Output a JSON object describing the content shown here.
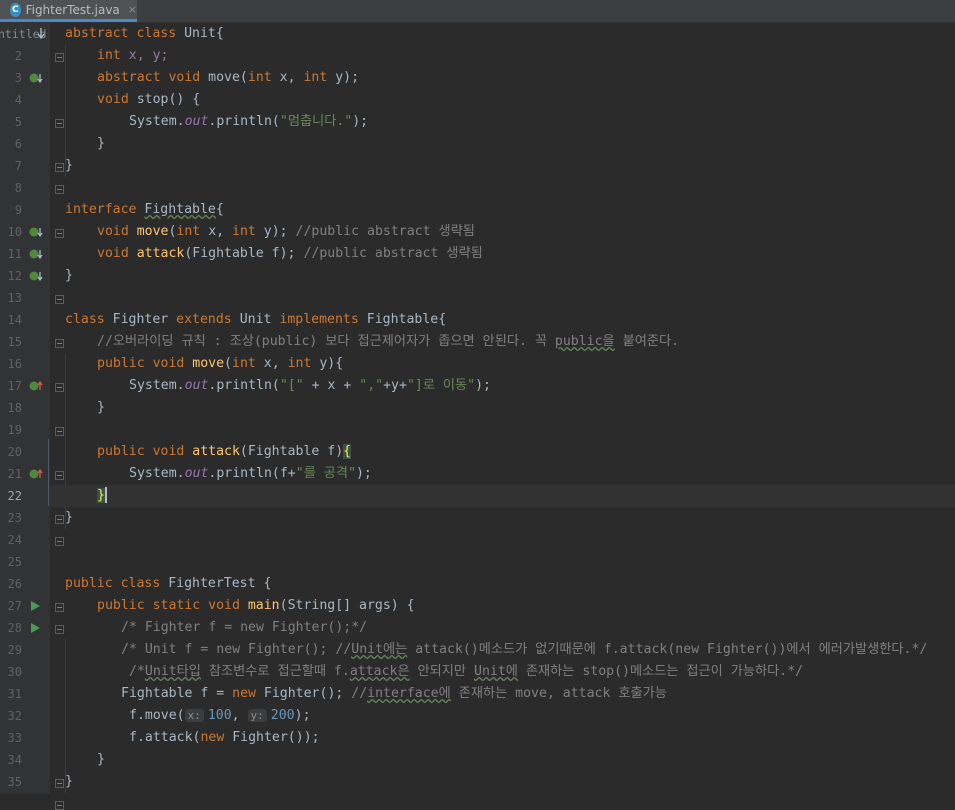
{
  "tab": {
    "title": "FighterTest.java",
    "close": "×",
    "icon_letter": "C"
  },
  "gutter": {
    "untitled_label": "ntitled"
  },
  "lines": [
    {
      "n": "1",
      "label": "ntitled"
    },
    {
      "n": "2"
    },
    {
      "n": "3"
    },
    {
      "n": "4"
    },
    {
      "n": "5"
    },
    {
      "n": "6"
    },
    {
      "n": "7"
    },
    {
      "n": "8"
    },
    {
      "n": "9"
    },
    {
      "n": "10"
    },
    {
      "n": "11"
    },
    {
      "n": "12"
    },
    {
      "n": "13"
    },
    {
      "n": "14"
    },
    {
      "n": "15"
    },
    {
      "n": "16"
    },
    {
      "n": "17"
    },
    {
      "n": "18"
    },
    {
      "n": "19"
    },
    {
      "n": "20"
    },
    {
      "n": "21"
    },
    {
      "n": "22"
    },
    {
      "n": "23"
    },
    {
      "n": "24"
    },
    {
      "n": "25"
    },
    {
      "n": "26"
    },
    {
      "n": "27"
    },
    {
      "n": "28"
    },
    {
      "n": "29"
    },
    {
      "n": "30"
    },
    {
      "n": "31"
    },
    {
      "n": "32"
    },
    {
      "n": "33"
    },
    {
      "n": "34"
    },
    {
      "n": "35"
    }
  ],
  "code": {
    "l1": {
      "kw": "abstract class ",
      "name": "Unit{"
    },
    "l2": {
      "kw": "int ",
      "rest": "x, y;"
    },
    "l3": {
      "kw1": "abstract void ",
      "fn": "move",
      "p1": "(",
      "kw2": "int ",
      "a": "x, ",
      "kw3": "int ",
      "b": "y);"
    },
    "l4": {
      "kw": "void ",
      "fn": "stop",
      "rest": "() {"
    },
    "l5": {
      "cls": "System.",
      "fld": "out",
      "call": ".println(",
      "str": "\"멈춥니다.\"",
      "end": ");"
    },
    "l6": {
      "text": "}"
    },
    "l7": {
      "text": "}"
    },
    "l9": {
      "kw": "interface ",
      "name": "Fightable",
      "rest": "{"
    },
    "l10": {
      "kw1": "void ",
      "fn": "move",
      "p": "(",
      "kw2": "int ",
      "a": "x, ",
      "kw3": "int ",
      "b": "y); ",
      "cm": "//public abstract 생략됨"
    },
    "l11": {
      "kw": "void ",
      "fn": "attack",
      "rest": "(Fightable f); ",
      "cm": "//public abstract 생략됨"
    },
    "l12": {
      "text": "}"
    },
    "l14": {
      "kw1": "class ",
      "name": "Fighter ",
      "kw2": "extends ",
      "sup": "Unit ",
      "kw3": "implements ",
      "itf": "Fightable{"
    },
    "l15": {
      "cm1": "//오버라이딩 규칙 : 조상(public) 보다 접근제어자가 좁으면 안된다. 꼭 ",
      "cm2": "public을",
      "cm3": " 붙여준다."
    },
    "l16": {
      "kw1": "public void ",
      "fn": "move",
      "p": "(",
      "kw2": "int ",
      "a": "x, ",
      "kw3": "int ",
      "b": "y){"
    },
    "l17": {
      "cls": "System.",
      "fld": "out",
      "call": ".println(",
      "s1": "\"[\"",
      "m1": " + x + ",
      "s2": "\",\"",
      "m2": "+y+",
      "s3": "\"]로 이동\"",
      "end": ");"
    },
    "l18": {
      "text": "}"
    },
    "l20": {
      "kw": "public void ",
      "fn": "attack",
      "rest": "(Fightable f)",
      "brace": "{"
    },
    "l21": {
      "cls": "System.",
      "fld": "out",
      "call": ".println(f+",
      "str": "\"를 공격\"",
      "end": ");"
    },
    "l22": {
      "brace": "}"
    },
    "l23": {
      "text": "}"
    },
    "l26": {
      "kw": "public class ",
      "name": "FighterTest {"
    },
    "l27": {
      "kw": "public static void ",
      "fn": "main",
      "rest": "(String[] args) {"
    },
    "l28": {
      "cm": "/* Fighter f = new Fighter();*/"
    },
    "l29": {
      "cm1": "/* Unit f = new Fighter(); //",
      "cm2": "Unit에는",
      "cm3": " attack()메소드가 없기때문에 f.attack(new Fighter())에서 에러가발생한다.*/"
    },
    "l30": {
      "cm1": "/*",
      "cm2": "Unit타입",
      "cm3": " 참조변수로 접근할때 f.",
      "cm4": "attack은",
      "cm5": " 안되지만 ",
      "cm6": "Unit에",
      "cm7": " 존재하는 stop()메소드는 접근이 가능하다.*/"
    },
    "l31": {
      "a": "Fightable f = ",
      "kw": "new ",
      "b": "Fighter(); ",
      "cm1": "//",
      "cm2": "interface에",
      "cm3": " 존재하는 move, attack 호출가능"
    },
    "l32": {
      "a": "f.move(",
      "h1": "x:",
      "n1": "100",
      ",": ", ",
      "h2": "y:",
      "n2": "200",
      "end": ");"
    },
    "l33": {
      "a": "f.attack(",
      "kw": "new ",
      "b": "Fighter());"
    },
    "l34": {
      "text": "}"
    },
    "l35": {
      "text": "}"
    }
  },
  "colors": {
    "keyword": "#cc7832",
    "function": "#ffc66d",
    "string": "#6a8759",
    "number": "#6897bb",
    "comment": "#808080",
    "background": "#2b2b2b"
  }
}
